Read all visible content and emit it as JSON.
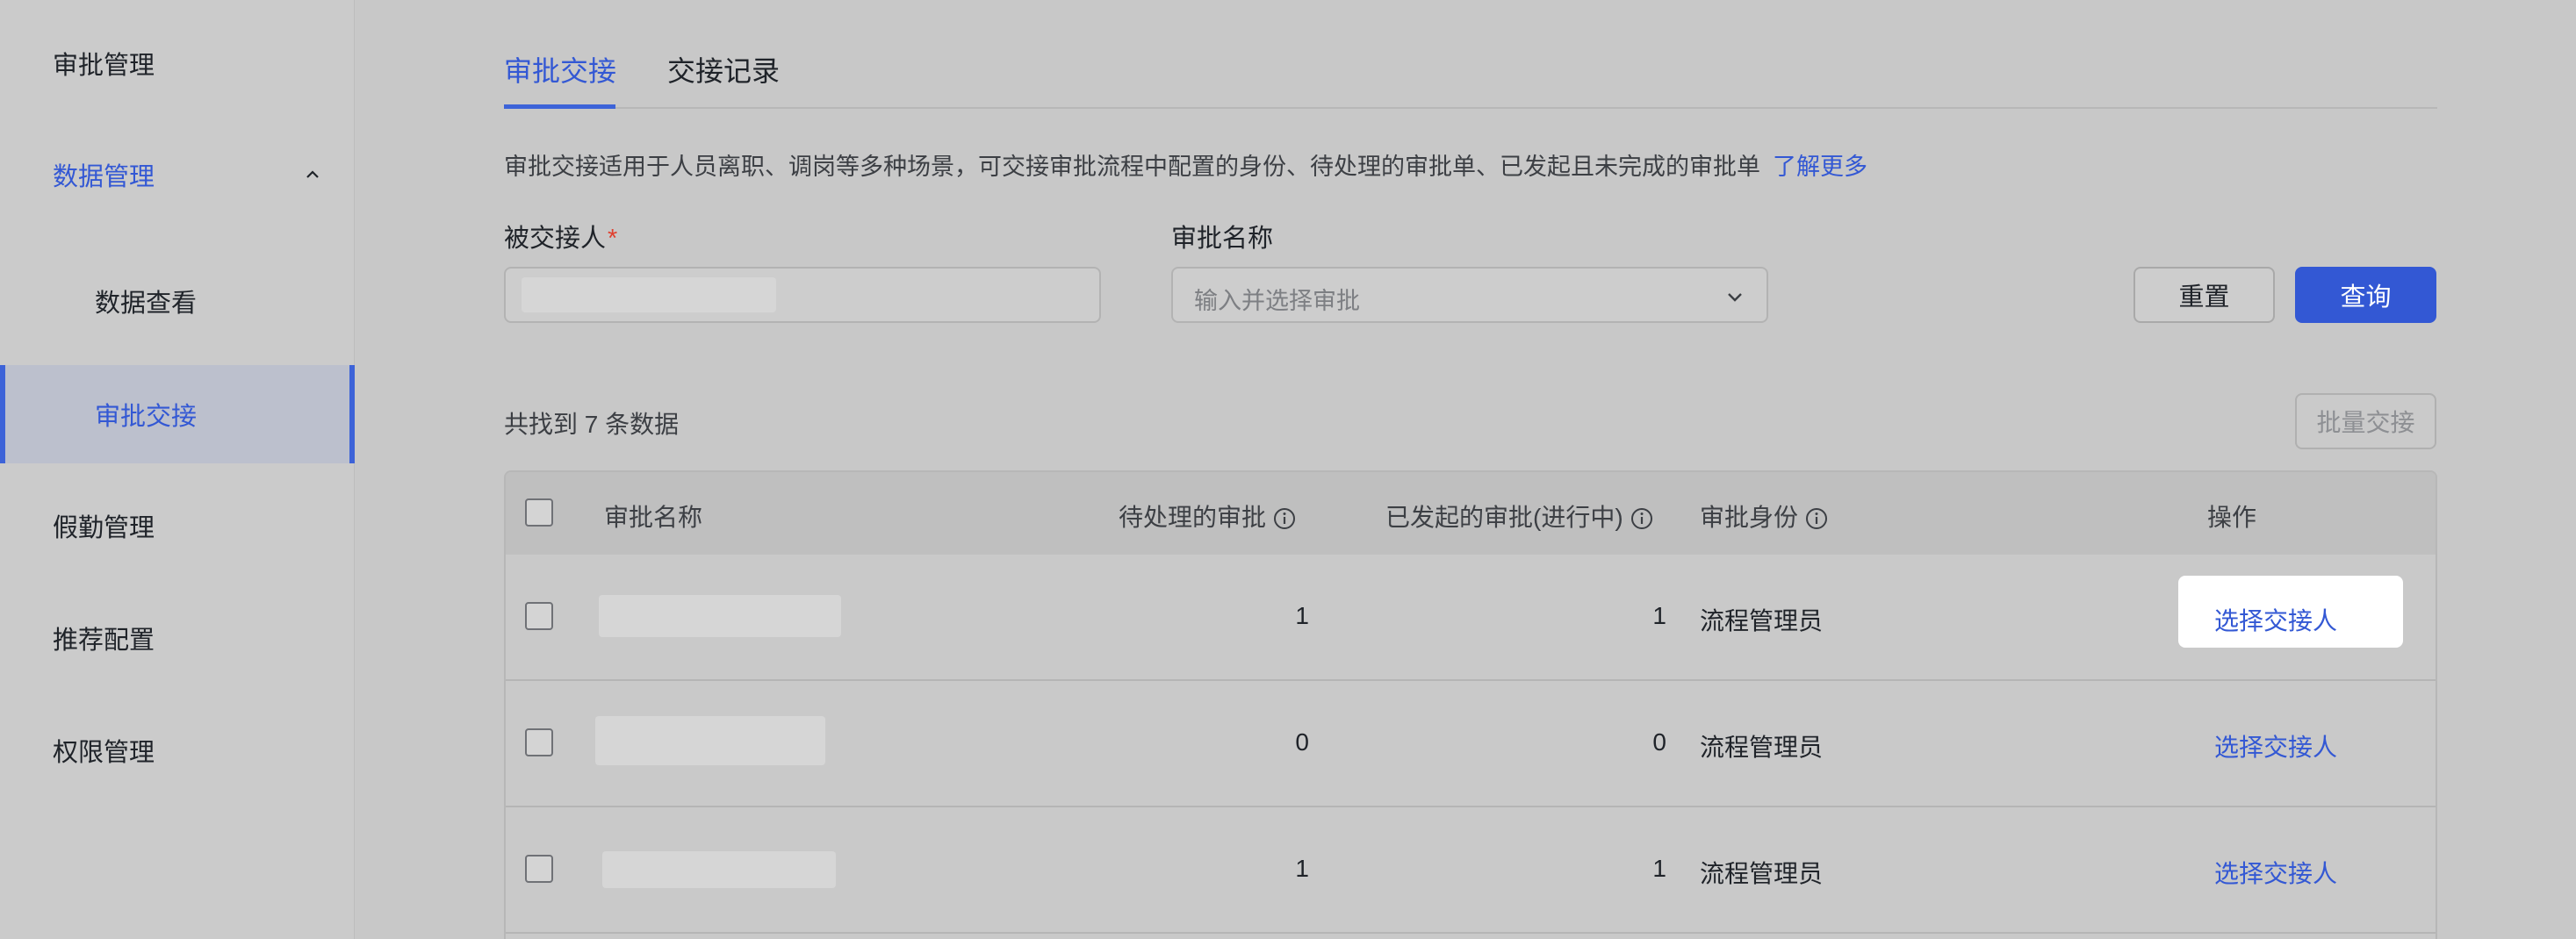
{
  "sidebar": {
    "items": [
      {
        "label": "审批管理"
      },
      {
        "label": "数据管理"
      },
      {
        "label": "数据查看"
      },
      {
        "label": "审批交接"
      },
      {
        "label": "假勤管理"
      },
      {
        "label": "推荐配置"
      },
      {
        "label": "权限管理"
      }
    ]
  },
  "tabs": [
    {
      "label": "审批交接"
    },
    {
      "label": "交接记录"
    }
  ],
  "description": {
    "text": "审批交接适用于人员离职、调岗等多种场景，可交接审批流程中配置的身份、待处理的审批单、已发起且未完成的审批单",
    "link": "了解更多"
  },
  "form": {
    "handover_label": "被交接人",
    "required_mark": "*",
    "approval_name_label": "审批名称",
    "approval_name_placeholder": "输入并选择审批",
    "reset_label": "重置",
    "query_label": "查询"
  },
  "results": {
    "count_text": "共找到 7 条数据",
    "batch_label": "批量交接"
  },
  "table": {
    "headers": {
      "name": "审批名称",
      "pending": "待处理的审批",
      "initiated": "已发起的审批(进行中)",
      "role": "审批身份",
      "action": "操作"
    },
    "rows": [
      {
        "pending": "1",
        "initiated": "1",
        "role": "流程管理员",
        "action": "选择交接人"
      },
      {
        "pending": "0",
        "initiated": "0",
        "role": "流程管理员",
        "action": "选择交接人"
      },
      {
        "pending": "1",
        "initiated": "1",
        "role": "流程管理员",
        "action": "选择交接人"
      }
    ]
  },
  "colors": {
    "accent": "#3358d4",
    "required": "#e0402f"
  }
}
